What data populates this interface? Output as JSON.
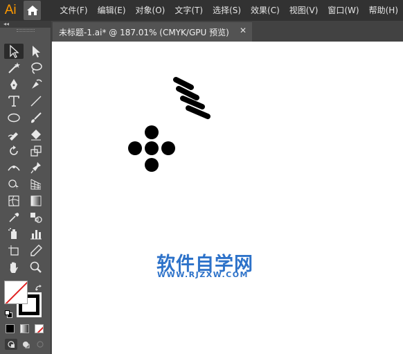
{
  "app": {
    "logo": "Ai"
  },
  "menu": [
    "文件(F)",
    "编辑(E)",
    "对象(O)",
    "文字(T)",
    "选择(S)",
    "效果(C)",
    "视图(V)",
    "窗口(W)",
    "帮助(H)"
  ],
  "document": {
    "tab_title": "未标题-1.ai* @ 187.01% (CMYK/GPU 预览)",
    "close_glyph": "✕"
  },
  "panel": {
    "collapse_glyph": "◂◂"
  },
  "tools": [
    "selection-tool-icon",
    "direct-selection-tool-icon",
    "magic-wand-tool-icon",
    "lasso-tool-icon",
    "pen-tool-icon",
    "curvature-tool-icon",
    "type-tool-icon",
    "line-segment-tool-icon",
    "ellipse-tool-icon",
    "paintbrush-tool-icon",
    "shaper-tool-icon",
    "eraser-tool-icon",
    "rotate-tool-icon",
    "scale-tool-icon",
    "width-tool-icon",
    "puppet-warp-tool-icon",
    "shape-builder-tool-icon",
    "perspective-grid-tool-icon",
    "mesh-tool-icon",
    "gradient-tool-icon",
    "eyedropper-tool-icon",
    "blend-tool-icon",
    "symbol-sprayer-tool-icon",
    "column-graph-tool-icon",
    "artboard-tool-icon",
    "slice-tool-icon",
    "hand-tool-icon",
    "zoom-tool-icon"
  ],
  "colors": {
    "fill": "#ffffff",
    "stroke": "#000000",
    "none_slash": "#e02020",
    "watermark": "#2d72c9",
    "logo": "#ff9a00"
  },
  "watermark": {
    "title": "软件自学网",
    "url": "WWW.RJZXW.COM"
  }
}
